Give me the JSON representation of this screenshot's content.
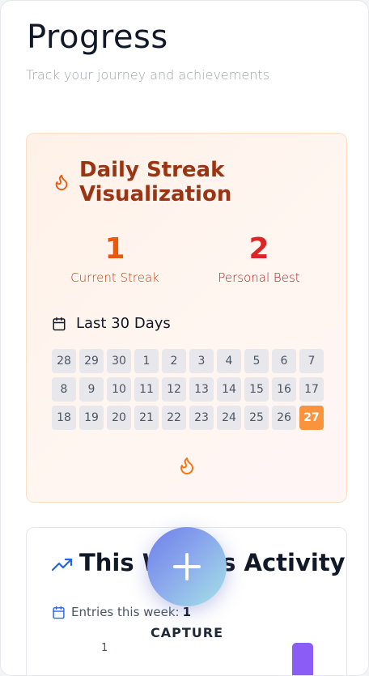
{
  "page": {
    "title": "Progress",
    "subtitle": "Track your journey and achievements"
  },
  "streak": {
    "title": "Daily Streak Visualization",
    "current_value": "1",
    "current_label": "Current Streak",
    "best_value": "2",
    "best_label": "Personal Best",
    "days_label": "Last 30 Days",
    "days": [
      "28",
      "29",
      "30",
      "1",
      "2",
      "3",
      "4",
      "5",
      "6",
      "7",
      "8",
      "9",
      "10",
      "11",
      "12",
      "13",
      "14",
      "15",
      "16",
      "17",
      "18",
      "19",
      "20",
      "21",
      "22",
      "23",
      "24",
      "25",
      "26",
      "27"
    ],
    "active_days": [
      "27"
    ],
    "colors": {
      "accent": "#fb923c",
      "title": "#9a3412",
      "current": "#ea580c",
      "best": "#dc2626"
    }
  },
  "activity": {
    "title": "This Week's Activity",
    "entries_label": "Entries this week:",
    "entries_count": "1",
    "axis_label": "1",
    "bar_color": "#8b5cf6"
  },
  "fab": {
    "label": "CAPTURE",
    "icon": "plus-icon"
  }
}
